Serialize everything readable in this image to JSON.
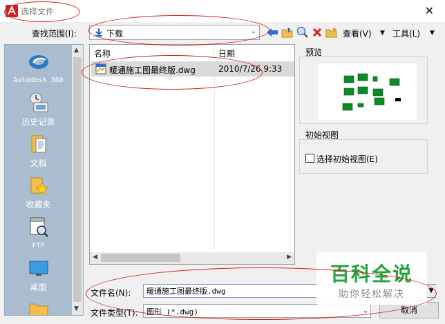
{
  "window": {
    "title": "选择文件",
    "close_glyph": "✕"
  },
  "lookin": {
    "label": "查找范围(I):",
    "value": "下载"
  },
  "toolbar": {
    "view_label": "查看(V)",
    "tools_label": "工具(L)"
  },
  "places": [
    {
      "label": "Autodesk 360",
      "icon": "cloud-icon"
    },
    {
      "label": "历史记录",
      "icon": "history-icon"
    },
    {
      "label": "文档",
      "icon": "documents-icon"
    },
    {
      "label": "收藏夹",
      "icon": "favorites-icon"
    },
    {
      "label": "FTP",
      "icon": "ftp-icon"
    },
    {
      "label": "桌面",
      "icon": "desktop-icon"
    }
  ],
  "filelist": {
    "columns": [
      "名称",
      "日期"
    ],
    "rows": [
      {
        "name": "暖通施工图最终版.dwg",
        "date": "2010/7/26 9:33"
      }
    ]
  },
  "preview": {
    "label": "预览"
  },
  "initial_view": {
    "group_label": "初始视图",
    "checkbox_label": "选择初始视图(E)",
    "checked": false
  },
  "filename": {
    "label": "文件名(N):",
    "value": "暖通施工图最终版.dwg"
  },
  "filetype": {
    "label": "文件类型(T):",
    "value": "图形 (*.dwg)"
  },
  "buttons": {
    "cancel": "取消"
  },
  "watermark": {
    "title": "百科全说",
    "subtitle": "助你轻松解决"
  },
  "colors": {
    "annotation": "#d42020",
    "watermark_green": "#1fa33a",
    "sidebar": "#aabdd0"
  }
}
